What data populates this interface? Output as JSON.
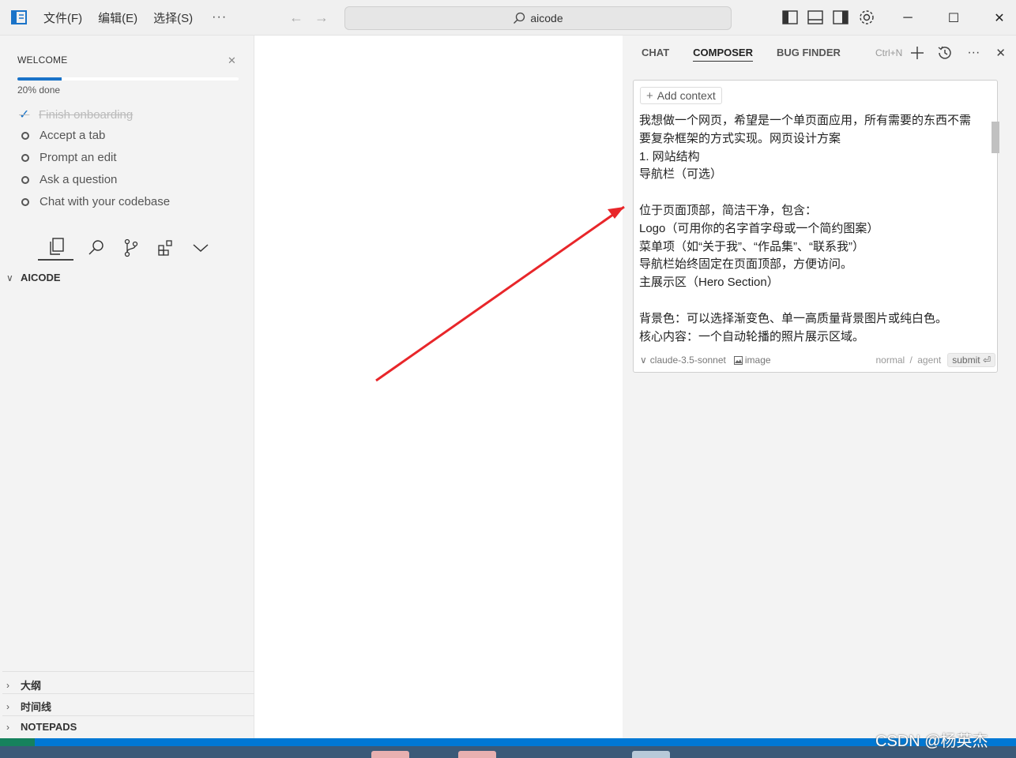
{
  "titlebar": {
    "menus": [
      "文件(F)",
      "编辑(E)",
      "选择(S)"
    ],
    "more": "···",
    "search_text": "aicode"
  },
  "welcome": {
    "title": "WELCOME",
    "progress_text": "20% done",
    "progress_fraction": 0.2,
    "tasks": [
      {
        "label": "Finish onboarding",
        "done": true
      },
      {
        "label": "Accept a tab",
        "done": false
      },
      {
        "label": "Prompt an edit",
        "done": false
      },
      {
        "label": "Ask a question",
        "done": false
      },
      {
        "label": "Chat with your codebase",
        "done": false
      }
    ]
  },
  "explorer": {
    "workspace": "AICODE",
    "sections": [
      "大纲",
      "时间线",
      "NOTEPADS"
    ]
  },
  "panel": {
    "tabs": [
      "CHAT",
      "COMPOSER",
      "BUG FINDER"
    ],
    "active_tab": "COMPOSER",
    "shortcut": "Ctrl+N",
    "add_context": "Add context",
    "prompt_lines": [
      "我想做一个网页，希望是一个单页面应用，所有需要的东西不需",
      "要复杂框架的方式实现。网页设计方案",
      "1. 网站结构",
      "导航栏（可选）",
      "",
      "位于页面顶部，简洁干净，包含：",
      "Logo（可用你的名字首字母或一个简约图案）",
      "菜单项（如“关于我”、“作品集”、“联系我”）",
      "导航栏始终固定在页面顶部，方便访问。",
      "主展示区（Hero Section）",
      "",
      "背景色：可以选择渐变色、单一高质量背景图片或纯白色。",
      "核心内容：一个自动轮播的照片展示区域。"
    ],
    "model": "claude-3.5-sonnet",
    "image_label": "image",
    "mode_normal": "normal",
    "mode_sep": "/",
    "mode_agent": "agent",
    "submit": "submit"
  },
  "watermark": "CSDN @杨英杰",
  "colors": {
    "accent": "#1a73c8",
    "statusbar": "#0078d4",
    "arrow": "#e8262a"
  }
}
